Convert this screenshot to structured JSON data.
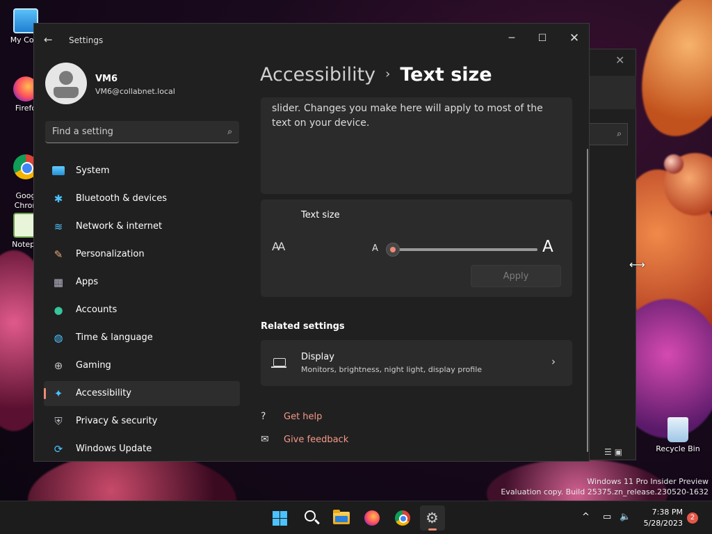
{
  "desktop": {
    "icons": [
      {
        "label": "My Com"
      },
      {
        "label": "Firefo"
      },
      {
        "label": "Goog\nChron"
      },
      {
        "label": "Notepa"
      },
      {
        "label": "Recycle Bin"
      }
    ],
    "watermark_line1": "Windows 11 Pro Insider Preview",
    "watermark_line2": "Evaluation copy. Build 25375.zn_release.230520-1632"
  },
  "window": {
    "title": "Settings",
    "back_icon": "←",
    "minimize_icon": "─",
    "maximize_icon": "☐",
    "close_icon": "✕"
  },
  "user": {
    "name": "VM6",
    "email": "VM6@collabnet.local"
  },
  "search": {
    "placeholder": "Find a setting",
    "value": "",
    "icon": "⌕"
  },
  "sidebar": {
    "items": [
      {
        "label": "System",
        "icon": ""
      },
      {
        "label": "Bluetooth & devices",
        "icon": "✱"
      },
      {
        "label": "Network & internet",
        "icon": "≋"
      },
      {
        "label": "Personalization",
        "icon": "✎"
      },
      {
        "label": "Apps",
        "icon": "▦"
      },
      {
        "label": "Accounts",
        "icon": "●"
      },
      {
        "label": "Time & language",
        "icon": "◍"
      },
      {
        "label": "Gaming",
        "icon": "⊕"
      },
      {
        "label": "Accessibility",
        "icon": "✦"
      },
      {
        "label": "Privacy & security",
        "icon": "⛨"
      },
      {
        "label": "Windows Update",
        "icon": "⟳"
      }
    ],
    "active_index": 8
  },
  "breadcrumb": {
    "parent": "Accessibility",
    "separator": "›",
    "current": "Text size"
  },
  "description": "slider. Changes you make here will apply to most of the text on your device.",
  "text_size": {
    "label": "Text size",
    "aa_icon": "AA",
    "min_label": "A",
    "max_label": "A",
    "slider_value_percent": 0,
    "apply_label": "Apply"
  },
  "related": {
    "title": "Related settings",
    "display_title": "Display",
    "display_subtitle": "Monitors, brightness, night light, display profile",
    "chevron": "›"
  },
  "links": {
    "help": "Get help",
    "help_icon": "?",
    "feedback": "Give feedback",
    "feedback_icon": "✉"
  },
  "background_window": {
    "close_icon": "✕",
    "search_icon": "⌕",
    "view_icons": "☰▣"
  },
  "cursor": "⟷",
  "taskbar": {
    "tray_chevron": "^",
    "network_icon": "▭",
    "volume_icon": "🔈",
    "time": "7:38 PM",
    "date": "5/28/2023",
    "notification_count": "2",
    "gear_glyph": "⚙"
  },
  "colors": {
    "accent": "#f08a76",
    "link": "#f59a88",
    "background": "#202020",
    "card": "#2b2b2b"
  }
}
